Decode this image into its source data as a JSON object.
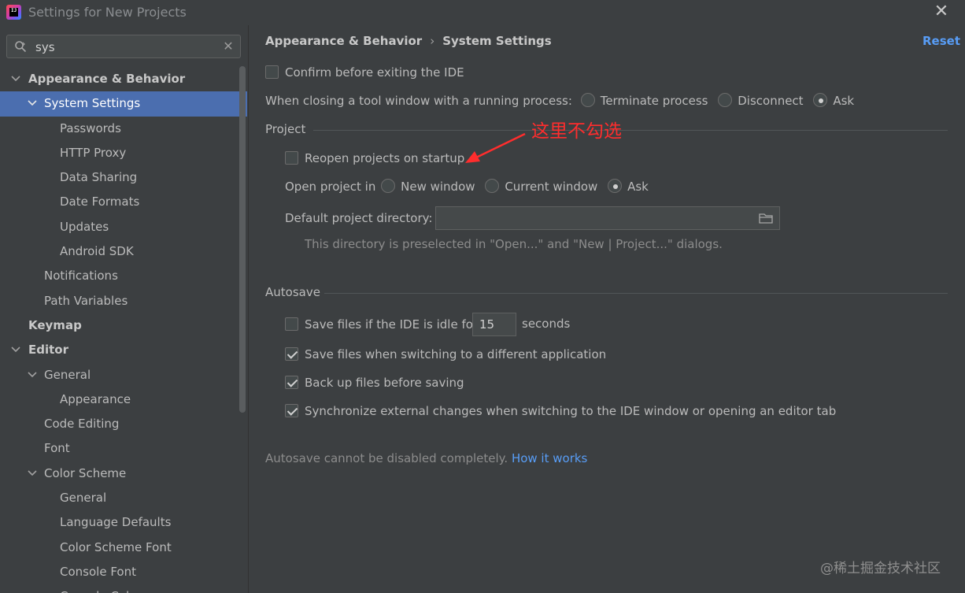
{
  "window": {
    "title": "Settings for New Projects",
    "close_glyph": "✕",
    "logo_text": "IJ"
  },
  "search": {
    "value": "sys",
    "placeholder": "",
    "clear_glyph": "✕"
  },
  "tree": [
    {
      "label": "Appearance & Behavior",
      "level": 0,
      "bold": true,
      "expanded": true
    },
    {
      "label": "System Settings",
      "level": 1,
      "expanded": true,
      "selected": true
    },
    {
      "label": "Passwords",
      "level": 2
    },
    {
      "label": "HTTP Proxy",
      "level": 2
    },
    {
      "label": "Data Sharing",
      "level": 2
    },
    {
      "label": "Date Formats",
      "level": 2
    },
    {
      "label": "Updates",
      "level": 2
    },
    {
      "label": "Android SDK",
      "level": 2
    },
    {
      "label": "Notifications",
      "level": 1
    },
    {
      "label": "Path Variables",
      "level": 1
    },
    {
      "label": "Keymap",
      "level": 0,
      "bold": true
    },
    {
      "label": "Editor",
      "level": 0,
      "bold": true,
      "expanded": true
    },
    {
      "label": "General",
      "level": 1,
      "expanded": true
    },
    {
      "label": "Appearance",
      "level": 2
    },
    {
      "label": "Code Editing",
      "level": 1
    },
    {
      "label": "Font",
      "level": 1
    },
    {
      "label": "Color Scheme",
      "level": 1,
      "expanded": true
    },
    {
      "label": "General",
      "level": 2
    },
    {
      "label": "Language Defaults",
      "level": 2
    },
    {
      "label": "Color Scheme Font",
      "level": 2
    },
    {
      "label": "Console Font",
      "level": 2
    },
    {
      "label": "Console Colors",
      "level": 2
    }
  ],
  "main": {
    "breadcrumb": {
      "part1": "Appearance & Behavior",
      "separator": "›",
      "part2": "System Settings"
    },
    "reset_label": "Reset",
    "confirm_exit": {
      "label": "Confirm before exiting the IDE",
      "checked": false
    },
    "closing_tool_window": {
      "label": "When closing a tool window with a running process:",
      "options": [
        {
          "label": "Terminate process",
          "selected": false
        },
        {
          "label": "Disconnect",
          "selected": false
        },
        {
          "label": "Ask",
          "selected": true
        }
      ]
    },
    "project": {
      "title": "Project",
      "reopen": {
        "label": "Reopen projects on startup",
        "checked": false
      },
      "open_in": {
        "label": "Open project in",
        "options": [
          {
            "label": "New window",
            "selected": false
          },
          {
            "label": "Current window",
            "selected": false
          },
          {
            "label": "Ask",
            "selected": true
          }
        ]
      },
      "default_dir_label": "Default project directory:",
      "default_dir_value": "",
      "default_dir_hint": "This directory is preselected in \"Open...\" and \"New | Project...\" dialogs."
    },
    "autosave": {
      "title": "Autosave",
      "idle": {
        "label_before": "Save files if the IDE is idle for",
        "value": "15",
        "label_after": "seconds",
        "checked": false
      },
      "switch_app": {
        "label": "Save files when switching to a different application",
        "checked": true
      },
      "backup": {
        "label": "Back up files before saving",
        "checked": true
      },
      "sync": {
        "label": "Synchronize external changes when switching to the IDE window or opening an editor tab",
        "checked": true
      },
      "note": "Autosave cannot be disabled completely.",
      "how_link": "How it works"
    }
  },
  "annotation": {
    "text": "这里不勾选",
    "color": "#ff2d2d"
  },
  "watermark": "@稀土掘金技术社区",
  "colors": {
    "background": "#3c3f41",
    "selection": "#4b6eaf",
    "link": "#589df6"
  }
}
